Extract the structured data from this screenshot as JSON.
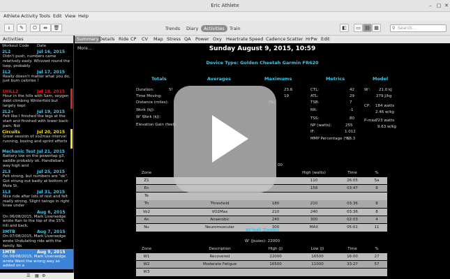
{
  "window": {
    "title": "Eric Athlete"
  },
  "menu": [
    "Athlete",
    "Activity",
    "Tools",
    "Edit",
    "View",
    "Help"
  ],
  "view_tabs": [
    "Trends",
    "Diary",
    "Activities",
    "Train"
  ],
  "active_view": "Activities",
  "search": {
    "placeholder": "Search..."
  },
  "left": {
    "header": "Activities",
    "col_workout": "Workout Code",
    "col_date": "Date",
    "rides": [
      {
        "code": "2L2",
        "date": "Jul 16, 2015",
        "note": "Didn't push, numbers came relatively easly. Whizzed round the loop, probably",
        "color": "#3fc7ea",
        "bar": ""
      },
      {
        "code": "1L2",
        "date": "Jul 17, 2015",
        "note": "Really doesn't matter what you do, just burn calories !",
        "color": "#3fc7ea",
        "bar": ""
      },
      {
        "code": "1HILL2",
        "date": "Jul 18, 2015",
        "note": "Hour in the hills with Sam, oxygen debt climbing Winterfold but largely kept",
        "color": "#e02020",
        "bar": "#e02020"
      },
      {
        "code": "2L2+",
        "date": "Jul 19, 2015",
        "note": "Felt like I finished the legs at the start and finished with lower back pain. Not",
        "color": "#3fc7ea",
        "bar": ""
      },
      {
        "code": "Circuits",
        "date": "Jul 20, 2015",
        "note": "Great session of vo2max interval running, boxing and sprint efforts",
        "color": "#f0e020",
        "bar": "#f0e020"
      },
      {
        "code": "Mechanic Test",
        "date": "Jul 21, 2015",
        "note": "Battery low on the powertap g3, saddle probably ok. Handlebars way high and",
        "color": "#3fc7ea",
        "bar": ""
      },
      {
        "code": "2L3",
        "date": "Jul 25, 2015",
        "note": "Felt strong, but numbers are \"ok\". Got strung out badly at bottom of Mole St,",
        "color": "#3fc7ea",
        "bar": ""
      },
      {
        "code": "1L3",
        "date": "Jul 31, 2015",
        "note": "Nice ride after lots of rest and felt really strong. Slight twinge in right knee under",
        "color": "#3fc7ea",
        "bar": ""
      },
      {
        "code": "",
        "date": "Aug 6, 2015",
        "note": "On 06/08/2015, Mark Liversedge wrote Ran to the top of the 15% hill and back,",
        "color": "#3fc7ea",
        "bar": ""
      },
      {
        "code": "3MTB",
        "date": "Aug 7, 2015",
        "note": "On 07/08/2015, Mark Liversedge wrote Undulating ride with the family. No",
        "color": "#3fc7ea",
        "bar": ""
      },
      {
        "code": "1MTB",
        "date": "Aug 9, 2015",
        "note": "On 09/08/2015, Mark Liversedge wrote Went the wrong way so added on a",
        "color": "#ffffff",
        "bar": "",
        "selected": true
      }
    ]
  },
  "tabs": [
    "Summary",
    "Details",
    "Ride",
    "CP",
    "CV",
    "Map",
    "Stress",
    "QA",
    "Power",
    "Oxy",
    "Heartrate",
    "Speed",
    "Cadence",
    "Scatter",
    "HrPw",
    "Edit"
  ],
  "active_tab": "Summary",
  "summary": {
    "more": "More...",
    "title": "Sunday August 9, 2015, 10:59",
    "device": "Device Type: Golden Cheetah Garmin FR620",
    "totals": {
      "heading": "Totals",
      "labels": [
        "Duration:",
        "Time Moving:",
        "Distance (miles):",
        "Work (kJ):",
        "W' Work (kJ):",
        "Elevation Gain (feet):"
      ],
      "values": [
        "5!",
        "",
        "",
        "",
        "",
        ""
      ]
    },
    "averages": {
      "heading": "Averages"
    },
    "maximums": {
      "heading": "Maximums",
      "values": [
        "23.6",
        "19",
        "(%)"
      ]
    },
    "metrics": {
      "heading": "Metrics",
      "labels": [
        "CTL:",
        "ATL:",
        "TSB:",
        "RR:",
        "TSS:",
        "NP (watts):",
        "IF:",
        "MMP Percentage (%):"
      ],
      "values": [
        "42",
        "29",
        "7",
        "-1",
        "80",
        "255",
        "1.012",
        "53.3"
      ]
    },
    "model": {
      "heading": "Model",
      "labels": [
        "W':",
        "",
        "CP:",
        "",
        "P-max:",
        ""
      ],
      "values": [
        "21.0 kJ",
        "279 J/kg",
        "184 watts",
        "2.46 w/kg",
        "723 watts",
        "9.63 w/kg"
      ]
    },
    "stray_value": "00"
  },
  "power_zones": {
    "headers": [
      "Zone",
      "",
      "",
      "High (watts)",
      "Time",
      "%"
    ],
    "rows": [
      {
        "zone": "Z1",
        "desc": "",
        "low": "",
        "high": "110",
        "time": "26:05",
        "pct": "5a"
      },
      {
        "zone": "En",
        "desc": "",
        "low": "",
        "high": "158",
        "time": "03:47",
        "pct": "8"
      },
      {
        "zone": "Te",
        "desc": "",
        "low": "",
        "high": "",
        "time": "",
        "pct": ""
      },
      {
        "zone": "Th",
        "desc": "Threshold",
        "low": "180",
        "high": "210",
        "time": "03:36",
        "pct": "8"
      },
      {
        "zone": "Vo2",
        "desc": "VO2Max",
        "low": "210",
        "high": "240",
        "time": "03:36",
        "pct": "8"
      },
      {
        "zone": "An",
        "desc": "Anaerobic",
        "low": "240",
        "high": "300",
        "time": "02:03",
        "pct": "4"
      },
      {
        "zone": "Nu",
        "desc": "Neuromuscular",
        "low": "300",
        "high": "MAX",
        "time": "05:01",
        "pct": "11"
      }
    ]
  },
  "wbal_zones": {
    "heading": "W'bal Zones",
    "sub": "W' (Joules): 22000",
    "headers": [
      "Zone",
      "Description",
      "High (J)",
      "Low (J)",
      "Time",
      "%"
    ],
    "rows": [
      {
        "zone": "W1",
        "desc": "Recovered",
        "high": "22000",
        "low": "16500",
        "time": "16:00",
        "pct": "27"
      },
      {
        "zone": "W2",
        "desc": "Moderate Fatigue",
        "high": "16500",
        "low": "11000",
        "time": "33:27",
        "pct": "57"
      },
      {
        "zone": "W3",
        "desc": "",
        "high": "",
        "low": "",
        "time": "",
        "pct": ""
      }
    ]
  }
}
